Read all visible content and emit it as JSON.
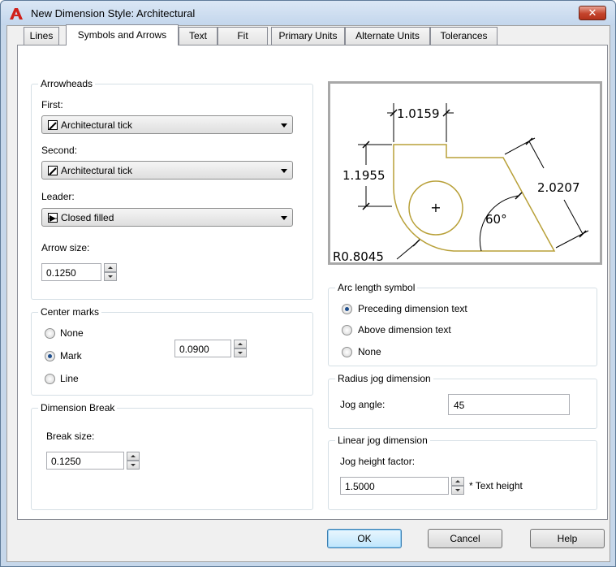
{
  "window": {
    "title": "New Dimension Style: Architectural",
    "close_label": "✕"
  },
  "tabs": [
    {
      "label": "Lines"
    },
    {
      "label": "Symbols and Arrows"
    },
    {
      "label": "Text"
    },
    {
      "label": "Fit"
    },
    {
      "label": "Primary Units"
    },
    {
      "label": "Alternate Units"
    },
    {
      "label": "Tolerances"
    }
  ],
  "arrowheads": {
    "title": "Arrowheads",
    "first_label": "First:",
    "first_value": "Architectural tick",
    "second_label": "Second:",
    "second_value": "Architectural tick",
    "leader_label": "Leader:",
    "leader_value": "Closed filled",
    "arrow_size_label": "Arrow size:",
    "arrow_size_value": "0.1250"
  },
  "center_marks": {
    "title": "Center marks",
    "options": [
      "None",
      "Mark",
      "Line"
    ],
    "selected": "Mark",
    "size_value": "0.0900"
  },
  "dimension_break": {
    "title": "Dimension Break",
    "break_size_label": "Break size:",
    "break_size_value": "0.1250"
  },
  "preview": {
    "dim_top": "1.0159",
    "dim_left": "1.1955",
    "dim_right": "2.0207",
    "angle": "60°",
    "radius": "R0.8045",
    "center_mark": "+"
  },
  "arc_length_symbol": {
    "title": "Arc length symbol",
    "options": [
      "Preceding dimension text",
      "Above dimension text",
      "None"
    ],
    "selected": "Preceding dimension text"
  },
  "radius_jog": {
    "title": "Radius jog dimension",
    "jog_angle_label": "Jog angle:",
    "jog_angle_value": "45"
  },
  "linear_jog": {
    "title": "Linear jog dimension",
    "height_factor_label": "Jog height factor:",
    "height_factor_value": "1.5000",
    "suffix": "* Text height"
  },
  "buttons": {
    "ok": "OK",
    "cancel": "Cancel",
    "help": "Help"
  },
  "colors": {
    "title_bar": "#c6d7ea",
    "close_button": "#c4442c",
    "preview_outline": "#b8a038"
  }
}
